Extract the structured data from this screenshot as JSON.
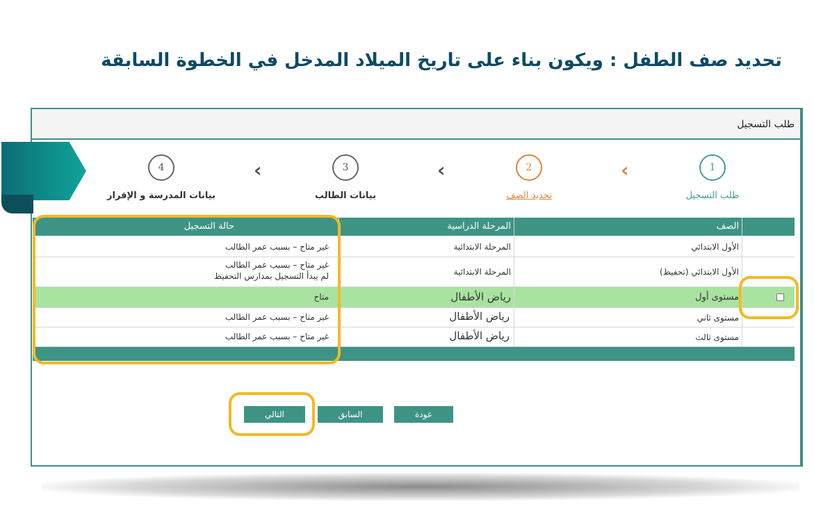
{
  "headline": "تحديد صف الطفل : ويكون بناء على تاريخ الميلاد المدخل في الخطوة السابقة",
  "panel": {
    "title": "طلب التسجيل"
  },
  "steps": [
    {
      "number": "1",
      "label": "طلب التسجيل",
      "state": "done"
    },
    {
      "number": "2",
      "label": "تحديد الصف",
      "state": "active"
    },
    {
      "number": "3",
      "label": "بيانات الطالب",
      "state": "pending"
    },
    {
      "number": "4",
      "label": "بيانات المدرسة و الإقرار",
      "state": "pending"
    }
  ],
  "chevron_glyph": "‹",
  "table": {
    "headers": {
      "grade": "الصف",
      "stage": "المرحلة الدراسية",
      "status": "حالة التسجيل"
    },
    "rows": [
      {
        "grade": "الأول الابتدائي",
        "stage": "المرحلة الابتدائية",
        "status": "غير متاح – بسبب عمر الطالب",
        "status2": ""
      },
      {
        "grade": "الأول الابتدائي (تحفيظ)",
        "stage": "المرحلة الابتدائية",
        "status": "غير متاح – بسبب عمر الطالب",
        "status2": "لم يبدأ التسجيل بمدارس التحفيظ"
      },
      {
        "grade": "مستوى أول",
        "stage": "رياض الأطفال",
        "status": "متاح",
        "status2": "",
        "selected": true
      },
      {
        "grade": "مستوى ثاني",
        "stage": "رياض الأطفال",
        "status": "غير متاح – بسبب عمر الطالب",
        "status2": ""
      },
      {
        "grade": "مستوى ثالث",
        "stage": "رياض الأطفال",
        "status": "غير متاح – بسبب عمر الطالب",
        "status2": ""
      }
    ]
  },
  "buttons": {
    "next": "التالي",
    "previous": "السابق",
    "back": "عودة"
  },
  "colors": {
    "accent": "#3e9484",
    "active_step": "#e0833c",
    "selected_row": "#a9e3a0",
    "highlight": "#f2b924",
    "headline": "#0d4a66"
  }
}
